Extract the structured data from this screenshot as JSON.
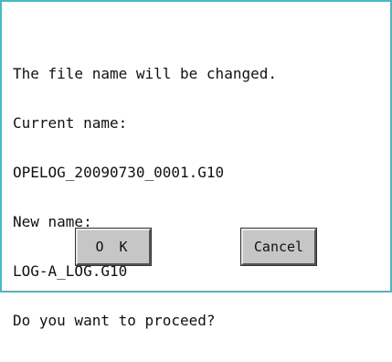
{
  "dialog": {
    "message_lines": [
      "The file name will be changed.",
      "Current name:",
      "OPELOG_20090730_0001.G10",
      "New name:",
      "LOG-A_LOG.G10",
      "Do you want to proceed?"
    ],
    "ok_label": "O K",
    "cancel_label": "Cancel",
    "border_color": "#4fb6bf",
    "button_color": "#c6c6c6"
  }
}
